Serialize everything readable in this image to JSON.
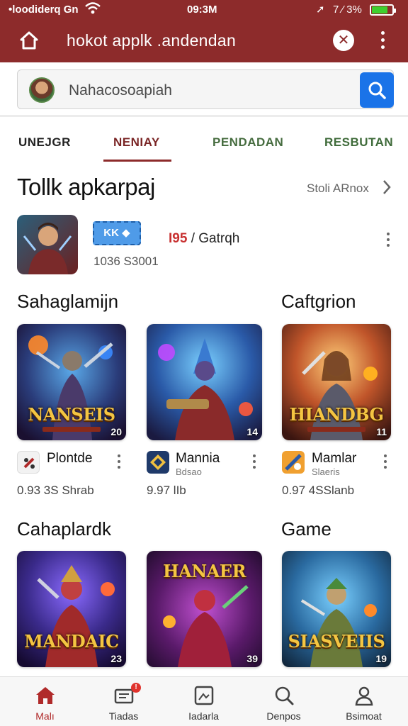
{
  "status_bar": {
    "carrier": "•loodiderq Gn",
    "time": "09:3M",
    "battery": "7 ⁄ 3%",
    "battery_level": 0.8
  },
  "app_bar": {
    "title": "hokot applk .andendan"
  },
  "search": {
    "placeholder": "Nahacosoapiah"
  },
  "tabs": [
    {
      "label": "UNEJGR"
    },
    {
      "label": "NENIAY",
      "active": true
    },
    {
      "label": "PENDADAN"
    },
    {
      "label": "RESBUTAN"
    }
  ],
  "section": {
    "title": "Tollk apkarpaj",
    "see_more": "Stoli ARnox"
  },
  "featured": {
    "badge": "KK",
    "rating_num": "I95",
    "rating_text": "/ Gatrqh",
    "downloads": "1036 S3001"
  },
  "categories": [
    {
      "name": "Sahaglamijn",
      "apps": [
        {
          "art_title": "NANSEIS",
          "rank": "20",
          "name": "Plontde",
          "dev": "",
          "meta": "0.93 3S Shrab"
        },
        {
          "art_title": "",
          "rank": "14",
          "name": "Mannia",
          "dev": "Bdsao",
          "meta": "9.97 lIb"
        }
      ]
    },
    {
      "name": "Caftgrion",
      "apps": [
        {
          "art_title": "HIANDBG",
          "rank": "11",
          "name": "Mamlar",
          "dev": "Slaeris",
          "meta": "0.97 4SSlanb"
        }
      ]
    },
    {
      "name": "Cahaplardk",
      "apps": [
        {
          "art_title": "MANDAIC",
          "rank": "23",
          "name": "",
          "dev": "",
          "meta": ""
        },
        {
          "art_title": "HANAER",
          "rank": "39",
          "name": "",
          "dev": "",
          "meta": ""
        }
      ]
    },
    {
      "name": "Game",
      "apps": [
        {
          "art_title": "SIASVEIIS",
          "rank": "19",
          "name": "",
          "dev": "",
          "meta": ""
        }
      ]
    }
  ],
  "bottom_nav": [
    {
      "label": "Malı",
      "icon": "home-icon",
      "active": true
    },
    {
      "label": "Tiadas",
      "icon": "inbox-icon",
      "badge": "!"
    },
    {
      "label": "Iadarla",
      "icon": "image-icon"
    },
    {
      "label": "Denpos",
      "icon": "search-icon"
    },
    {
      "label": "Bsimoat",
      "icon": "profile-icon"
    }
  ],
  "colors": {
    "brand": "#8d2b2b",
    "search_button": "#1a73e8",
    "active_tab": "#7a2525"
  }
}
